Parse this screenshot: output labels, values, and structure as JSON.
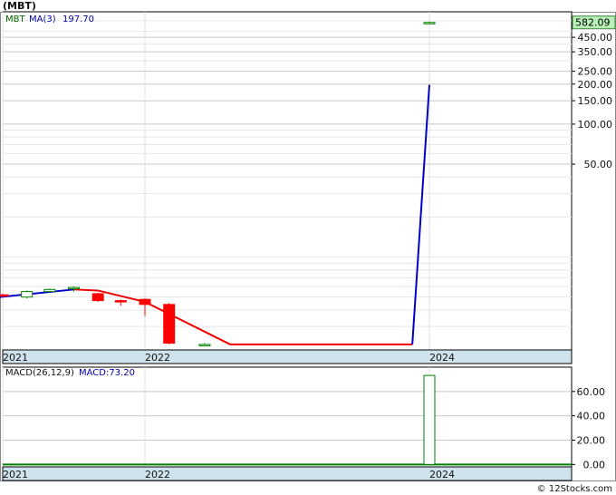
{
  "title": "(MBT)",
  "credit": "© 12Stocks.com",
  "colors": {
    "frame": "#000000",
    "grid": "#c8c8c8",
    "up": "#008000",
    "down": "#ff0000",
    "ma_up": "#0000cc",
    "ma_down": "#ee0000",
    "axis_band": "#cfe3ee",
    "price_tag_bg": "#b8f0b8",
    "text_green": "#006400",
    "text_blue": "#0000aa"
  },
  "chart_data": [
    {
      "type": "candlestick",
      "legend": {
        "symbol": "MBT",
        "ma_label": "MA(3)",
        "ma_value": "197.70"
      },
      "last_price": "582.09",
      "yscale": "log",
      "ylim": [
        2,
        700
      ],
      "y_ticks": [
        "450.00",
        "350.00",
        "250.00",
        "200.00",
        "150.00",
        "100.00",
        "50.00"
      ],
      "y_tick_values": [
        450,
        350,
        250,
        200,
        150,
        100,
        50
      ],
      "x_labels": [
        "2021",
        "2022",
        "2024"
      ],
      "x_label_values": [
        2021.0,
        2022.0,
        2024.0
      ],
      "xlim": [
        2021.0,
        2025.0
      ],
      "candles": [
        {
          "x": 2021.0,
          "o": 5.2,
          "h": 5.3,
          "l": 5.0,
          "c": 5.1
        },
        {
          "x": 2021.17,
          "o": 5.0,
          "h": 5.6,
          "l": 4.9,
          "c": 5.5
        },
        {
          "x": 2021.33,
          "o": 5.5,
          "h": 5.8,
          "l": 5.4,
          "c": 5.7
        },
        {
          "x": 2021.5,
          "o": 5.8,
          "h": 6.0,
          "l": 5.5,
          "c": 5.9
        },
        {
          "x": 2021.67,
          "o": 5.3,
          "h": 5.4,
          "l": 4.6,
          "c": 4.7
        },
        {
          "x": 2021.83,
          "o": 4.7,
          "h": 4.8,
          "l": 4.3,
          "c": 4.6
        },
        {
          "x": 2022.0,
          "o": 4.8,
          "h": 4.9,
          "l": 3.6,
          "c": 4.4
        },
        {
          "x": 2022.17,
          "o": 4.4,
          "h": 4.5,
          "l": 2.2,
          "c": 2.25
        },
        {
          "x": 2022.42,
          "o": 2.2,
          "h": 2.25,
          "l": 2.15,
          "c": 2.2
        },
        {
          "x": 2024.0,
          "o": 580,
          "h": 590,
          "l": 575,
          "c": 582.09
        }
      ],
      "ma_line": [
        {
          "x": 2020.9,
          "y": 4.9,
          "trend": "up"
        },
        {
          "x": 2021.5,
          "y": 5.7,
          "trend": "up"
        },
        {
          "x": 2021.67,
          "y": 5.6,
          "trend": "down"
        },
        {
          "x": 2022.0,
          "y": 4.6,
          "trend": "down"
        },
        {
          "x": 2022.6,
          "y": 2.2,
          "trend": "down"
        },
        {
          "x": 2023.88,
          "y": 2.2,
          "trend": "down"
        },
        {
          "x": 2024.0,
          "y": 197.7,
          "trend": "up"
        }
      ]
    },
    {
      "type": "bar",
      "legend": {
        "label": "MACD(26,12,9)",
        "macd_label": "MACD:73.20"
      },
      "ylim": [
        -2,
        80
      ],
      "y_ticks": [
        "60.00",
        "40.00",
        "20.00",
        "0.00"
      ],
      "y_tick_values": [
        60,
        40,
        20,
        0
      ],
      "x_labels": [
        "2021",
        "2022",
        "2024"
      ],
      "x_label_values": [
        2021.0,
        2022.0,
        2024.0
      ],
      "xlim": [
        2021.0,
        2025.0
      ],
      "bars": [
        {
          "x": 2024.0,
          "value": 73.2
        }
      ]
    }
  ]
}
